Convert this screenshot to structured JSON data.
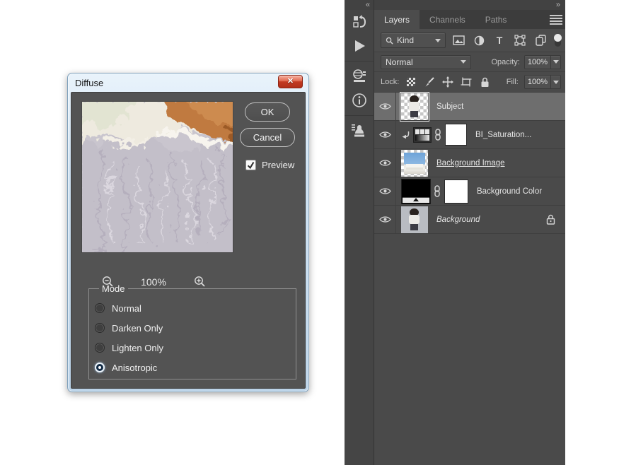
{
  "dialog": {
    "title": "Diffuse",
    "ok_label": "OK",
    "cancel_label": "Cancel",
    "preview_label": "Preview",
    "preview_checked": true,
    "zoom_level": "100%",
    "mode": {
      "legend": "Mode",
      "options": [
        {
          "label": "Normal",
          "selected": false
        },
        {
          "label": "Darken Only",
          "selected": false
        },
        {
          "label": "Lighten Only",
          "selected": false
        },
        {
          "label": "Anisotropic",
          "selected": true
        }
      ]
    }
  },
  "dock": {
    "collapse_icon": "«",
    "expand_icon": "»"
  },
  "panel": {
    "tabs": [
      {
        "label": "Layers",
        "active": true
      },
      {
        "label": "Channels",
        "active": false
      },
      {
        "label": "Paths",
        "active": false
      }
    ],
    "filter_row": {
      "kind_label": "Kind",
      "type_filter_glyph": "T"
    },
    "blend_row": {
      "blend_mode": "Normal",
      "opacity_label": "Opacity:",
      "opacity_value": "100%"
    },
    "lock_row": {
      "lock_label": "Lock:",
      "fill_label": "Fill:",
      "fill_value": "100%"
    },
    "layers": [
      {
        "name": "Subject",
        "selected": true
      },
      {
        "name": "BI_Saturation...",
        "clipped": true,
        "has_mask": true
      },
      {
        "name": "Background Image",
        "underlined": true
      },
      {
        "name": "Background Color",
        "has_mask": true
      },
      {
        "name": "Background",
        "italic": true,
        "locked": true
      }
    ]
  },
  "colors": {
    "panel_bg": "#4a4a4a",
    "strip_bg": "#454545",
    "selected_row_bg": "#6e6e6e",
    "dialog_content_bg": "#535353",
    "dialog_glass": "#cfe2f2",
    "close_button_red": "#c33a22",
    "preview_orange": "#c07a3f",
    "preview_lavender": "#c7c3cc"
  }
}
